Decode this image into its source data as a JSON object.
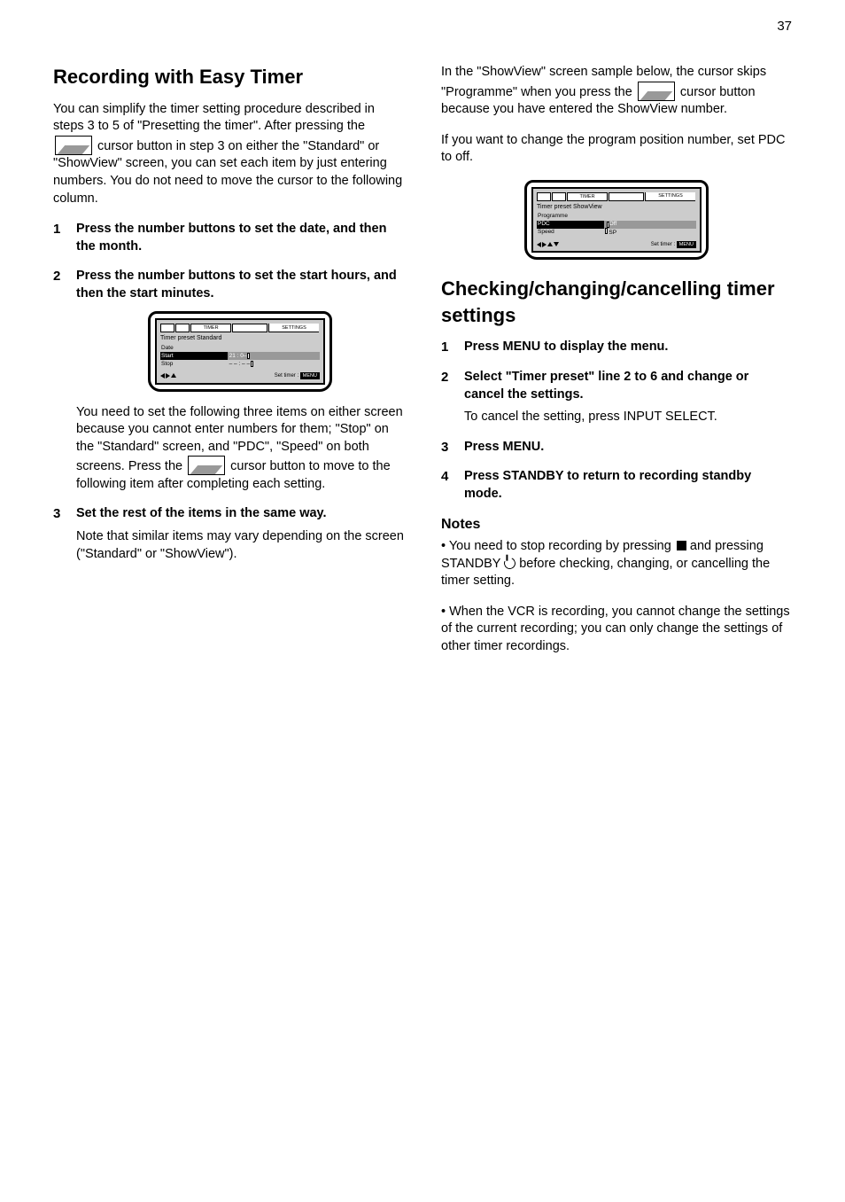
{
  "page_number": "37",
  "left": {
    "heading": "Recording with Easy Timer",
    "intro_pre": "You can simplify the timer setting procedure described in steps 3 to 5 of \"Presetting the timer\". After pressing the ",
    "intro_post": " cursor button in step 3 on either the \"Standard\" or \"ShowView\" screen, you can set each item by just entering numbers. You do not need to move the cursor to the following column.",
    "steps": [
      "Press the number buttons to set the date, and then the month.",
      "Press the number buttons to set the start hours, and then the start minutes."
    ],
    "step2_note_pre": "You need to set the following three items on either screen because you cannot enter numbers for them; \"Stop\" on the \"Standard\" screen, and \"PDC\", \"Speed\" on both screens. Press the ",
    "step2_note_post": " cursor button to move to the following item after completing each setting.",
    "step3": "Set the rest of the items in the same way.",
    "step3_note": "Note that similar items may vary depending on the screen (\"Standard\" or \"ShowView\").",
    "osd": {
      "tabs": [
        "",
        "",
        "TIMER",
        "",
        "SETTINGS"
      ],
      "title": "Timer preset  Standard",
      "row_date": "Date",
      "row_start_label": "Start",
      "row_start_val": "21 : 0–",
      "row_stop_label": "Stop",
      "row_stop_val": "– – : – –",
      "footer_label": "Set timer :",
      "footer_btn": "MENU"
    }
  },
  "right": {
    "intro_pre": "In the \"ShowView\" screen sample below, the cursor skips \"Programme\" when you press the ",
    "intro_post": " cursor button because you have entered the ShowView number.",
    "tip_line": "If you want to change the program position number, set PDC to off.",
    "checking_heading": "Checking/changing/cancelling timer settings",
    "checking_steps": [
      "Press MENU to display the menu.",
      "Select \"Timer preset\" line 2 to 6 and change or cancel the settings.",
      "Press MENU.",
      "Press STANDBY to return to recording standby mode."
    ],
    "step2_sub": "To cancel the setting, press INPUT SELECT.",
    "notes_heading": "Notes",
    "notes": [
      "You need to stop recording by pressing",
      "and pressing STANDBY",
      "before checking, changing, or cancelling the timer setting.",
      "When the VCR is recording, you cannot change the settings of the current recording; you can only change the settings of other timer recordings."
    ],
    "osd": {
      "tabs": [
        "",
        "",
        "TIMER",
        "",
        "SETTINGS"
      ],
      "title": "Timer preset  ShowView",
      "row_prog": "Programme",
      "row_pdc_label": "PDC",
      "row_pdc_val": "Off",
      "row_speed_label": "Speed",
      "row_speed_val": "SP",
      "footer_label": "Set timer :",
      "footer_btn": "MENU"
    }
  }
}
